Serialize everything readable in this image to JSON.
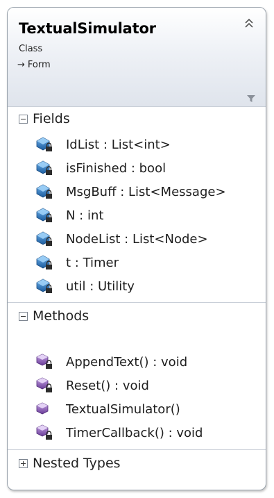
{
  "class": {
    "name": "TextualSimulator",
    "stereotype": "Class",
    "base_type": "Form"
  },
  "icons": {
    "collapse": "double-chevron-up-icon",
    "filter": "filter-icon",
    "field": "private-field-icon",
    "private_method": "private-method-icon",
    "public_method": "public-method-icon"
  },
  "colors": {
    "field_icon": "#2a6fb3",
    "method_icon": "#7a4fa8",
    "border": "#9aa3ad"
  },
  "sections": {
    "fields": {
      "label": "Fields",
      "items": [
        "IdList : List<int>",
        "isFinished : bool",
        "MsgBuff : List<Message>",
        "N : int",
        "NodeList : List<Node>",
        "t : Timer",
        "util : Utility"
      ]
    },
    "methods": {
      "label": "Methods",
      "items": [
        {
          "text": "AppendText() : void",
          "private": true
        },
        {
          "text": "Reset() : void",
          "private": true
        },
        {
          "text": "TextualSimulator()",
          "private": false
        },
        {
          "text": "TimerCallback() : void",
          "private": true
        }
      ]
    },
    "nested_types": {
      "label": "Nested Types"
    }
  }
}
